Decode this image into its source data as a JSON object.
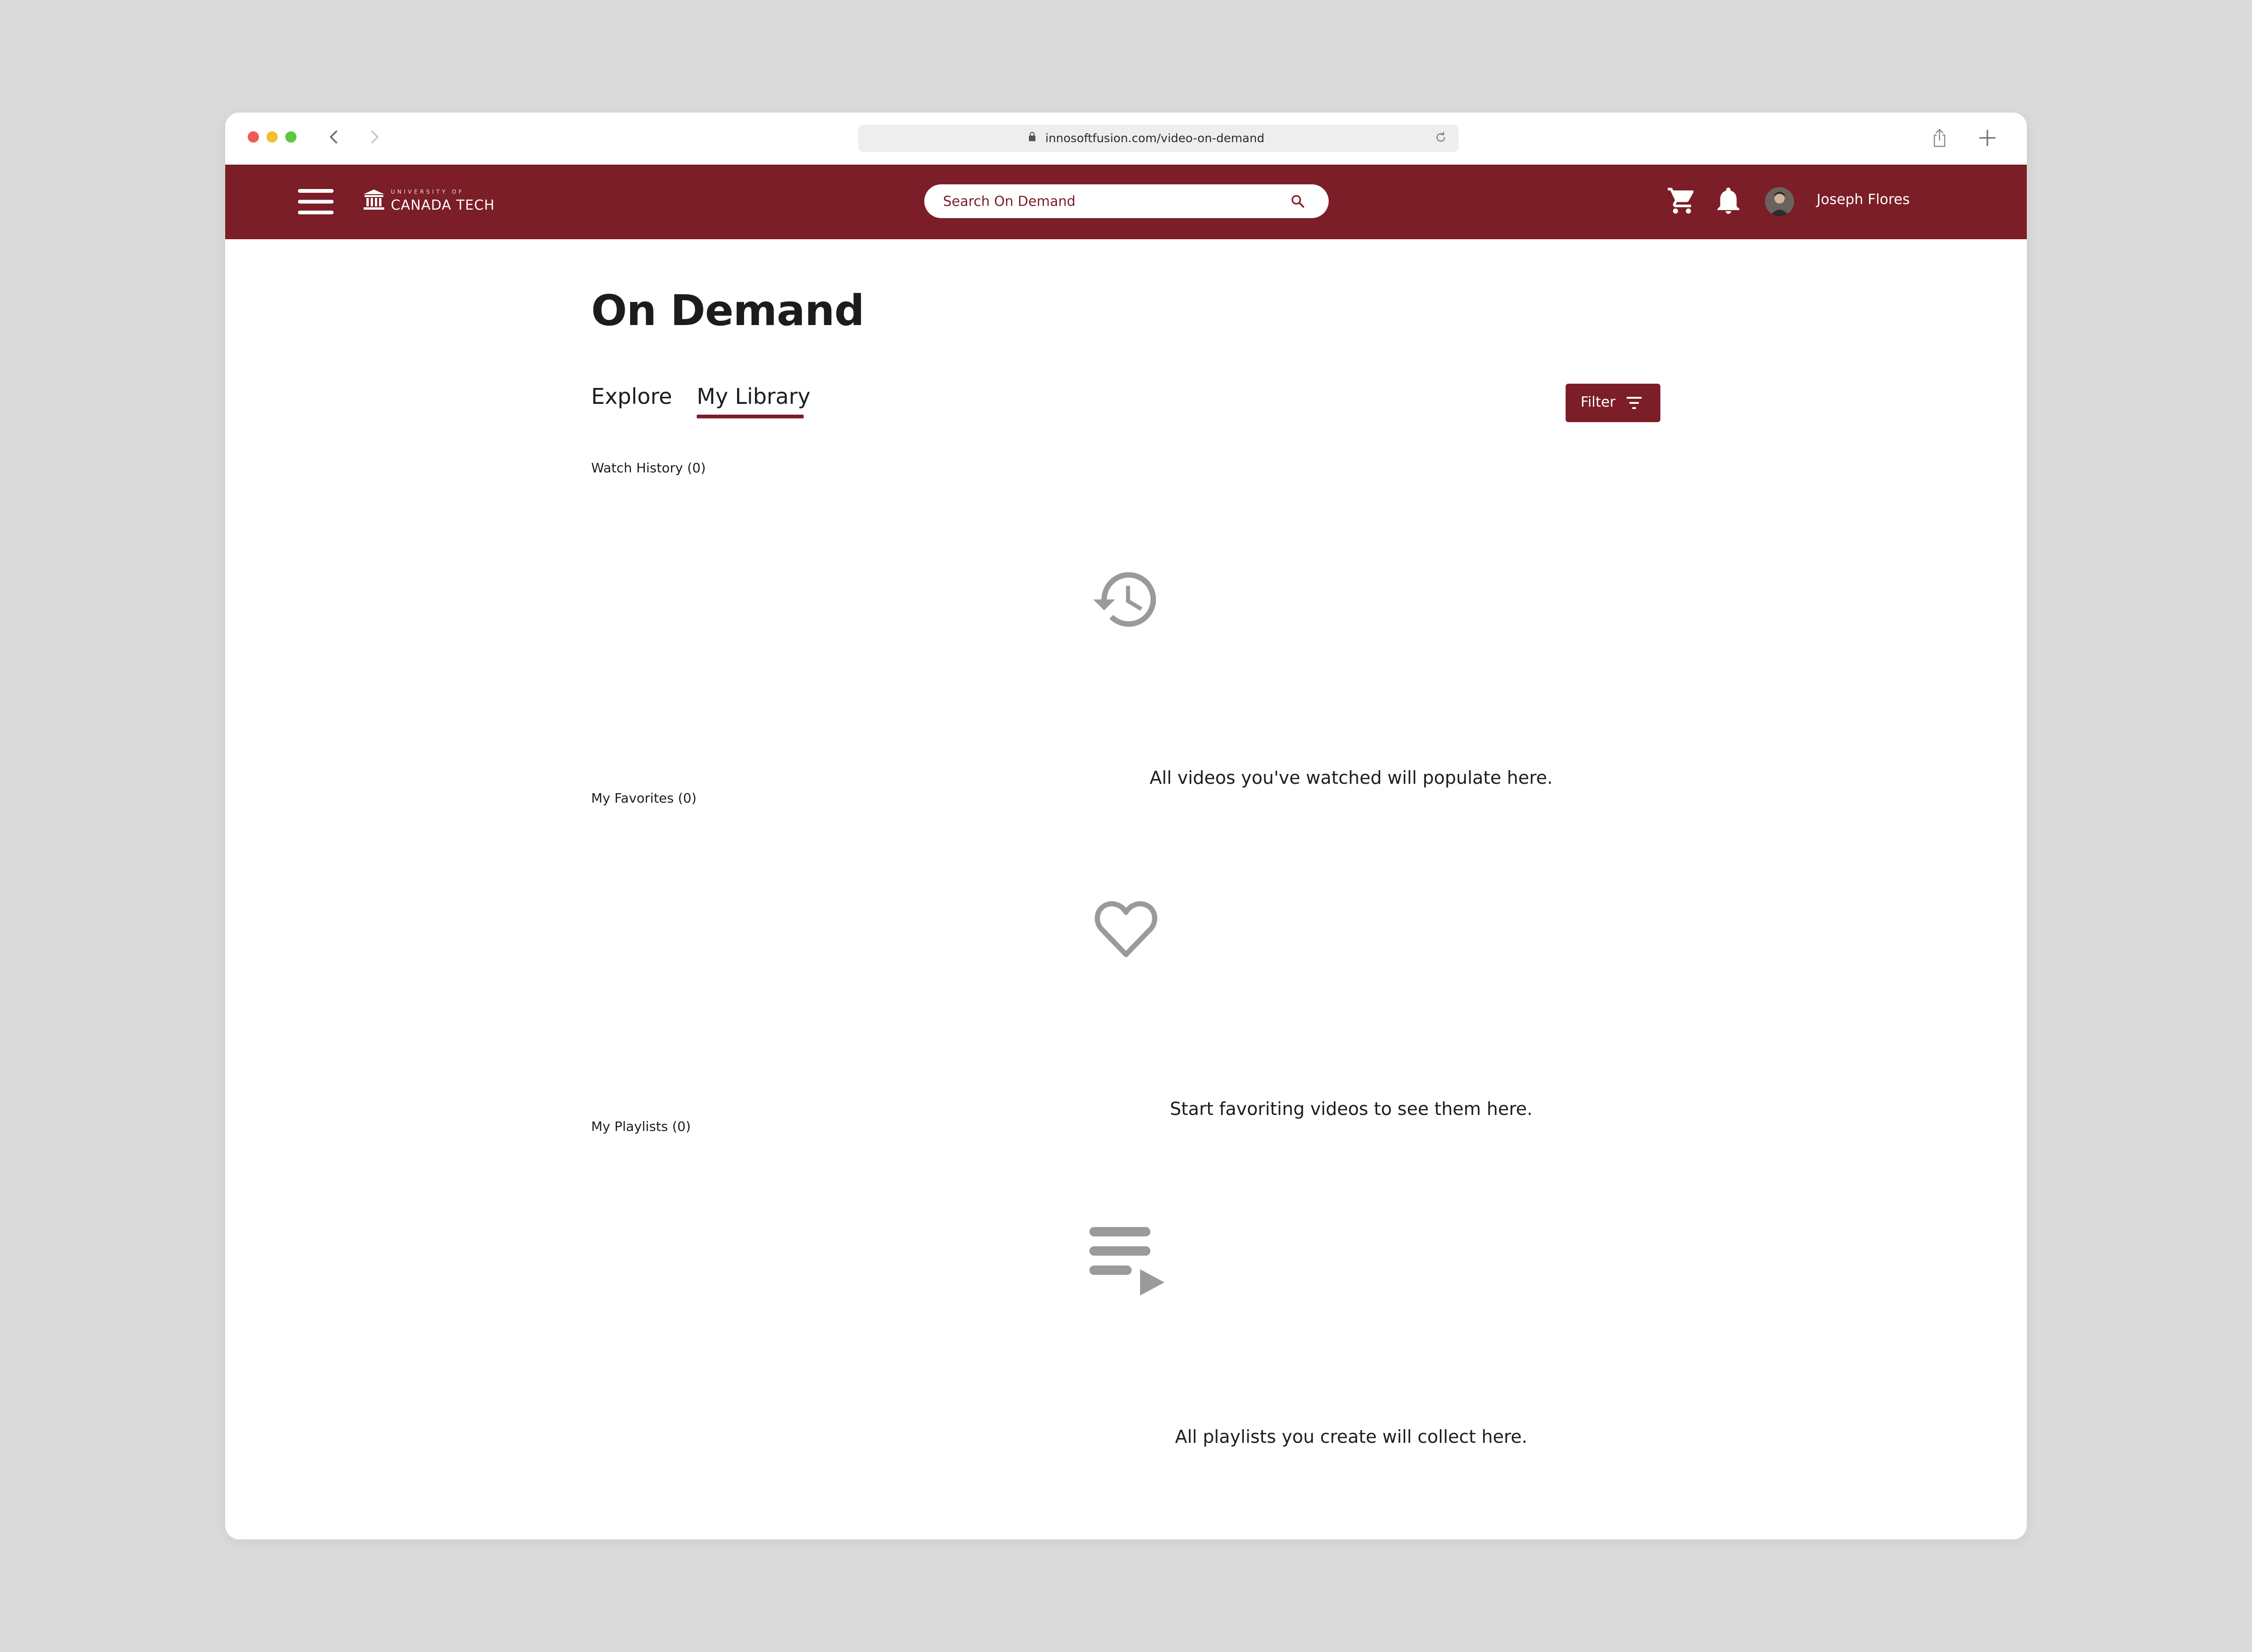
{
  "browser": {
    "url": "innosoftfusion.com/video-on-demand"
  },
  "header": {
    "brand_small": "UNIVERSITY OF",
    "brand_name": "CANADA TECH",
    "search_placeholder": "Search On Demand",
    "user_name": "Joseph Flores"
  },
  "page": {
    "title": "On Demand",
    "tabs": [
      {
        "label": "Explore",
        "active": false
      },
      {
        "label": "My Library",
        "active": true
      }
    ],
    "filter_label": "Filter"
  },
  "sections": [
    {
      "heading": "Watch History (0)",
      "icon": "history-icon",
      "empty_message": "All videos you've watched will populate here."
    },
    {
      "heading": "My Favorites (0)",
      "icon": "heart-icon",
      "empty_message": "Start favoriting videos to see them here."
    },
    {
      "heading": "My Playlists (0)",
      "icon": "playlist-icon",
      "empty_message": "All playlists you create will collect here."
    }
  ],
  "colors": {
    "brand": "#7b1e27",
    "icon_gray": "#9a9a9a",
    "background": "#dadada"
  }
}
